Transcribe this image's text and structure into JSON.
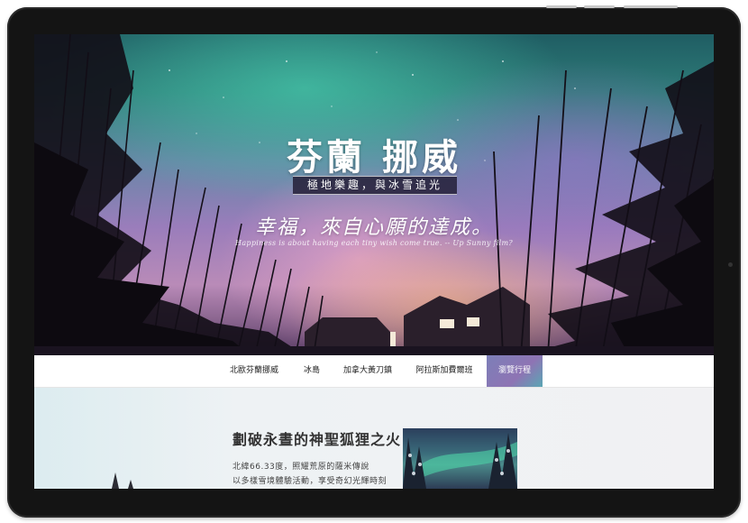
{
  "hero": {
    "title": "芬蘭 挪威",
    "subtitle": "極地樂趣，與冰雪追光",
    "script_line": "幸福，來自心願的達成。",
    "quote": "Happiness is about having each tiny wish come true. -- Up Sunny film?"
  },
  "nav": {
    "items": [
      {
        "label": "北歐芬蘭挪威",
        "active": false
      },
      {
        "label": "冰島",
        "active": false
      },
      {
        "label": "加拿大黃刀鎮",
        "active": false
      },
      {
        "label": "阿拉斯加費爾班",
        "active": false
      },
      {
        "label": "瀏覽行程",
        "active": true
      }
    ]
  },
  "section": {
    "title": "劃破永晝的神聖狐狸之火",
    "line1": "北緯66.33度，照耀荒原的薩米傳說",
    "line2": "以多樣雪境體驗活動，享受奇幻光輝時刻"
  },
  "colors": {
    "accent_active": "#8a78b6",
    "device_frame": "#141414"
  }
}
